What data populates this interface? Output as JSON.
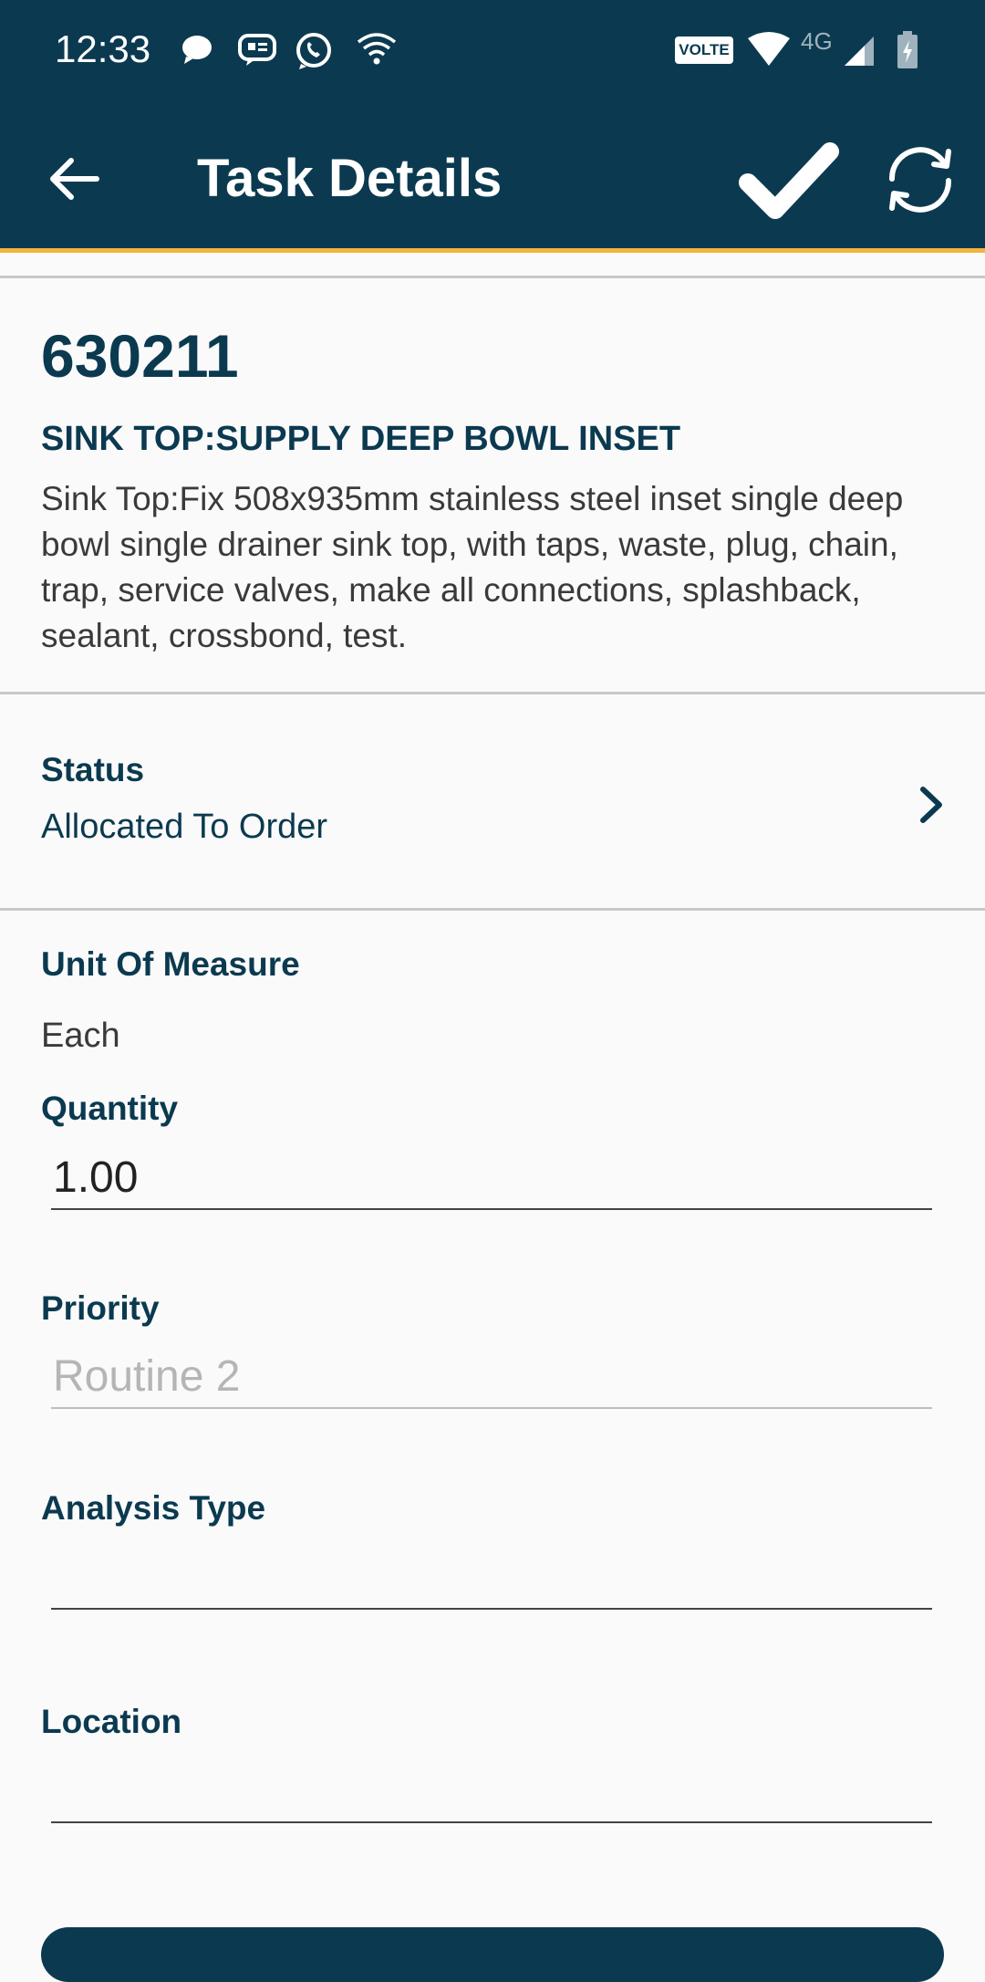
{
  "status_bar": {
    "time": "12:33",
    "network_badge": "VOLTE",
    "network_type": "4G"
  },
  "app_bar": {
    "title": "Task Details"
  },
  "task": {
    "number": "630211",
    "title": "SINK TOP:SUPPLY DEEP BOWL INSET",
    "description": "Sink Top:Fix 508x935mm stainless steel inset single deep bowl single drainer sink top, with taps, waste, plug, chain, trap, service valves, make all connections, splashback, sealant, crossbond, test."
  },
  "status": {
    "label": "Status",
    "value": "Allocated To Order"
  },
  "fields": {
    "unit_of_measure": {
      "label": "Unit Of Measure",
      "value": "Each"
    },
    "quantity": {
      "label": "Quantity",
      "value": "1.00"
    },
    "priority": {
      "label": "Priority",
      "placeholder": "Routine 2"
    },
    "analysis_type": {
      "label": "Analysis Type",
      "value": ""
    },
    "location": {
      "label": "Location",
      "value": ""
    }
  },
  "colors": {
    "primary": "#0b3a50",
    "accent": "#f2b43c",
    "background": "#fafafa"
  }
}
